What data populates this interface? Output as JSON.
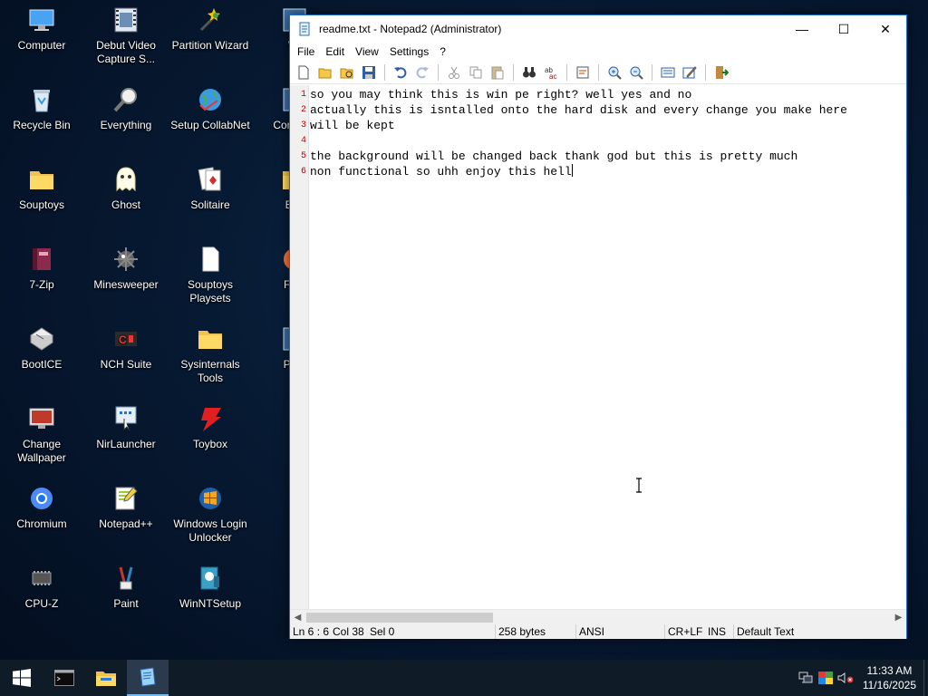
{
  "desktop": {
    "icons": [
      {
        "label": "Computer",
        "icon": "computer-icon"
      },
      {
        "label": "Debut Video Capture S...",
        "icon": "film-icon"
      },
      {
        "label": "Partition Wizard",
        "icon": "wand-icon"
      },
      {
        "label": "Wi",
        "icon": "app-icon"
      },
      {
        "label": "Recycle Bin",
        "icon": "recycle-bin-icon"
      },
      {
        "label": "Everything",
        "icon": "magnifier-icon"
      },
      {
        "label": "Setup CollabNet",
        "icon": "globe-icon"
      },
      {
        "label": "Com Pro",
        "icon": "app-icon"
      },
      {
        "label": "Souptoys",
        "icon": "folder-icon"
      },
      {
        "label": "Ghost",
        "icon": "ghost-icon"
      },
      {
        "label": "Solitaire",
        "icon": "cards-icon"
      },
      {
        "label": "Exp",
        "icon": "folder-icon"
      },
      {
        "label": "7-Zip",
        "icon": "archive-icon"
      },
      {
        "label": "Minesweeper",
        "icon": "mine-icon"
      },
      {
        "label": "Souptoys Playsets",
        "icon": "document-icon"
      },
      {
        "label": "Firef",
        "icon": "firefox-icon"
      },
      {
        "label": "BootICE",
        "icon": "bootice-icon"
      },
      {
        "label": "NCH Suite",
        "icon": "nch-icon"
      },
      {
        "label": "Sysinternals Tools",
        "icon": "folder-icon"
      },
      {
        "label": "PEN",
        "icon": "app-icon"
      },
      {
        "label": "Change Wallpaper",
        "icon": "wallpaper-icon"
      },
      {
        "label": "NirLauncher",
        "icon": "launcher-icon"
      },
      {
        "label": "Toybox",
        "icon": "toybox-icon"
      },
      {
        "label": "Chromium",
        "icon": "chromium-icon"
      },
      {
        "label": "Notepad++",
        "icon": "notepadpp-icon"
      },
      {
        "label": "Windows Login Unlocker",
        "icon": "windows-icon"
      },
      {
        "label": "CPU-Z",
        "icon": "chip-icon"
      },
      {
        "label": "Paint",
        "icon": "paint-icon"
      },
      {
        "label": "WinNTSetup",
        "icon": "setup-icon"
      }
    ]
  },
  "window": {
    "title": "readme.txt - Notepad2 (Administrator)",
    "controls": {
      "minimize": "—",
      "maximize": "☐",
      "close": "✕"
    },
    "menu": [
      "File",
      "Edit",
      "View",
      "Settings",
      "?"
    ],
    "line_numbers": [
      "1",
      "2",
      "3",
      "4",
      "5",
      "6"
    ],
    "lines": [
      "so you may think this is win pe right? well yes and no",
      "actually this is isntalled onto the hard disk and every change you make here",
      "will be kept",
      "",
      "the background will be changed back thank god but this is pretty much",
      "non functional so uhh enjoy this hell"
    ],
    "status": {
      "position": "Ln 6 : 6",
      "column": "Col 38",
      "selection": "Sel 0",
      "size": "258 bytes",
      "encoding": "ANSI",
      "eol": "CR+LF",
      "mode": "INS",
      "scheme": "Default Text"
    }
  },
  "taskbar": {
    "time": "11:33 AM",
    "date": "11/16/2025"
  },
  "colors": {
    "accent": "#1c6ec4",
    "line_number": "#c00000",
    "taskbar": "#101b28"
  }
}
